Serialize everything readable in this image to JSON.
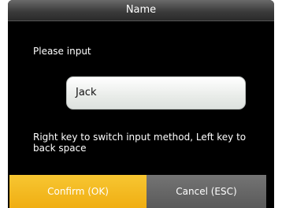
{
  "dialog": {
    "title": "Name",
    "prompt": "Please input",
    "input_value": "Jack",
    "hint": "Right key to switch input method, Left key to back space"
  },
  "buttons": {
    "confirm_label": "Confirm (OK)",
    "cancel_label": "Cancel (ESC)"
  },
  "colors": {
    "confirm_bg": "#f0ae12",
    "cancel_bg": "#5a5a5a",
    "background": "#000000"
  }
}
